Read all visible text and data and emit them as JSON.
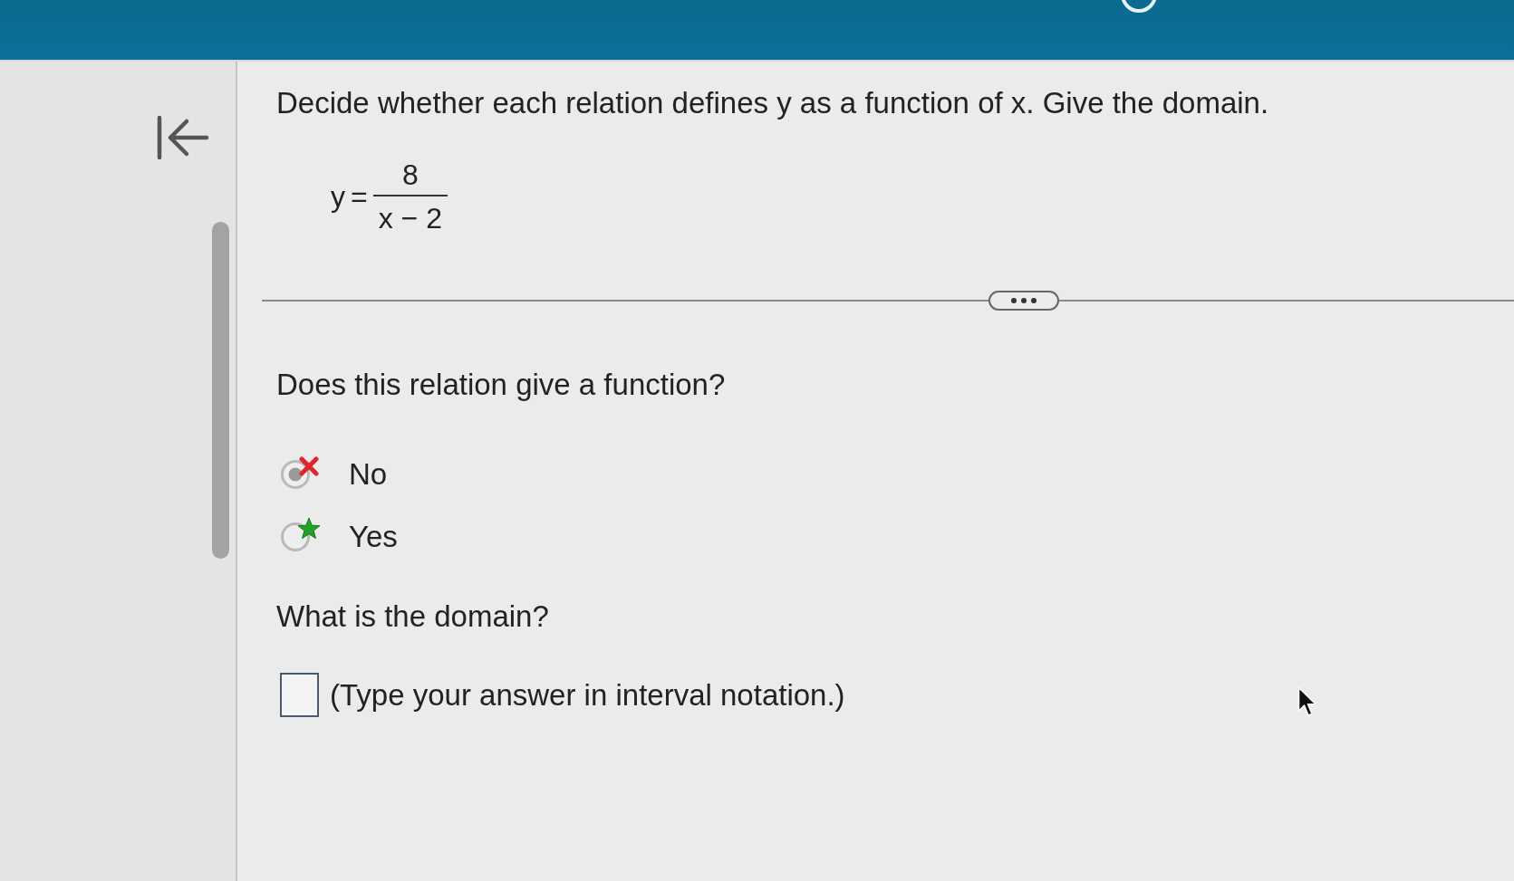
{
  "question": {
    "prompt": "Decide whether each relation defines y as a function of x. Give the domain.",
    "equation": {
      "lhs": "y",
      "relation": "=",
      "numerator": "8",
      "denominator": "x − 2"
    }
  },
  "parts": [
    {
      "kind": "choice",
      "prompt": "Does this relation give a function?",
      "options": [
        {
          "label": "No",
          "selected": true,
          "correct": false
        },
        {
          "label": "Yes",
          "selected": false,
          "correct": true
        }
      ]
    },
    {
      "kind": "answer",
      "prompt": "What is the domain?",
      "instruction": "(Type your answer in interval notation.)"
    }
  ]
}
